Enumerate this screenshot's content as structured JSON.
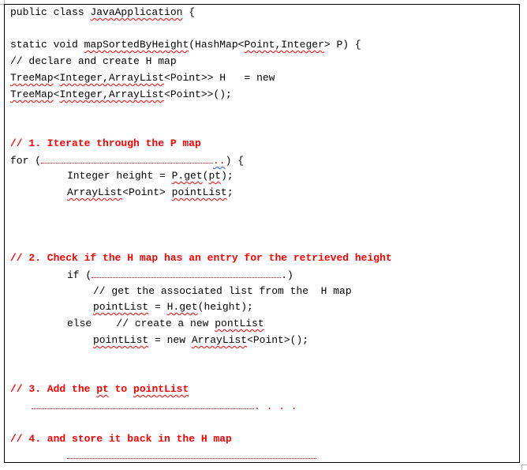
{
  "code": {
    "class_decl": {
      "keyword": "public class ",
      "name": "JavaApplication",
      "brace": " {"
    },
    "method_decl": {
      "prefix": "static void ",
      "name": "mapSortedByHeight",
      "paren_open": "(HashMap<",
      "generic_args": "Point,Integer",
      "suffix": "> P) {"
    },
    "comment_declare": "// declare and create H map",
    "treemap_line1": {
      "type_a": "TreeMap",
      "lt": "<",
      "type_b": "Integer,ArrayList",
      "rest": "<Point>> H   = new"
    },
    "treemap_line2": {
      "type_a": "TreeMap",
      "lt": "<",
      "type_b": "Integer,ArrayList",
      "rest": "<Point>>();"
    },
    "step1_comment": "// 1. Iterate through the P map",
    "for_line": {
      "keyword": "for (",
      "dots_tail": "..",
      "close": ") {"
    },
    "height_line": {
      "prefix": "Integer height = ",
      "call": "P.get",
      "paren": "(",
      "arg": "pt",
      "end": ");"
    },
    "pointlist_decl": {
      "type": "ArrayList",
      "generic": "<Point> ",
      "var": "pointList",
      "end": ";"
    },
    "step2_comment": "// 2. Check if the H map has an entry for the retrieved height",
    "if_line": {
      "keyword": "if (",
      "dots_tail": ".)"
    },
    "comment_get": "// get the associated list from the  H map",
    "get_line": {
      "var": "pointList",
      "mid": " = ",
      "call": "H.get",
      "end": "(height);"
    },
    "else_line": {
      "keyword": "else    ",
      "comment": "// create a new ",
      "misspelled": "pontList"
    },
    "new_line": {
      "var": "pointList",
      "mid": " = new ",
      "type": "ArrayList",
      "end": "<Point>();"
    },
    "step3_comment": {
      "prefix": "// 3. Add the ",
      "pt": "pt",
      "mid": " to ",
      "list": "pointList"
    },
    "step3_dots_tail": ". . . .",
    "step4_comment": "// 4. and store it back in the H map"
  }
}
